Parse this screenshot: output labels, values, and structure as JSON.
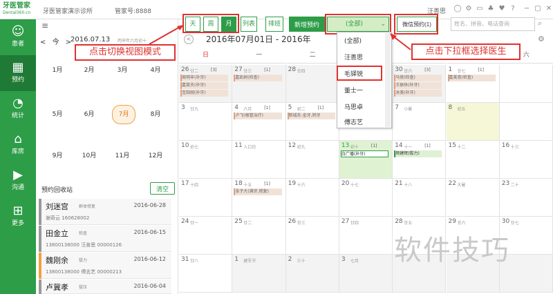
{
  "app": {
    "logo_name": "牙医管家",
    "logo_sub": "Dental360.cn",
    "clinic": "牙医管家演示诊所",
    "manager_label": "管家号:8888",
    "user": "汪善思"
  },
  "sidebar": [
    {
      "label": "患者",
      "icon": "person-icon"
    },
    {
      "label": "预约",
      "icon": "calendar-icon",
      "active": true
    },
    {
      "label": "统计",
      "icon": "pie-chart-icon"
    },
    {
      "label": "库房",
      "icon": "home-icon"
    },
    {
      "label": "沟通",
      "icon": "play-icon"
    },
    {
      "label": "更多",
      "icon": "grid-icon"
    }
  ],
  "left": {
    "prev": "<",
    "today": "今",
    "next": ">",
    "date": "2016.07.13",
    "lunar": "丙申年六月初十",
    "months": [
      "1月",
      "2月",
      "3月",
      "4月",
      "5月",
      "6月",
      "7月",
      "8月",
      "9月",
      "10月",
      "11月",
      "12月"
    ],
    "selected_month": "7月",
    "recall_title": "预约回收站",
    "clear": "清空",
    "recalls": [
      {
        "name": "刘迷宫",
        "tag": "群体修复",
        "date": "2016-06-28",
        "l2": "谢奇云            160628002",
        "color": "#999999"
      },
      {
        "name": "田金立",
        "tag": "检查",
        "date": "2016-06-15",
        "l2": "13800138000  汪善思    00000126",
        "color": "#999999"
      },
      {
        "name": "魏刚余",
        "tag": "拔力",
        "date": "2016-06-12",
        "l2": "13800138000  傅志艺    00000213",
        "color": "#f0a040"
      },
      {
        "name": "卢冀孝",
        "tag": "拔压",
        "date": "2016-06-04",
        "l2": "",
        "color": "#999999"
      }
    ]
  },
  "toolbar": {
    "view_day": "天",
    "view_week": "周",
    "view_month": "月",
    "view_list": "列表",
    "view_schedule": "排班",
    "new_appointment": "新增预约",
    "doctor_select": "(全部)",
    "wechat": "微信预约(1)",
    "search_placeholder": "姓名、拼音、电话查询"
  },
  "calendar": {
    "range": "2016年07月01日 - 2016年",
    "weekdays": [
      "日",
      "一",
      "二",
      "三",
      "四",
      "五",
      "六"
    ],
    "rows": [
      [
        {
          "d": "26",
          "lu": "廿二",
          "cnt": "[3]",
          "grey": true,
          "events": [
            "周明丰(补牙)",
            "嘉棠夫(补牙)",
            "宝田胡(补牙)"
          ]
        },
        {
          "d": "27",
          "lu": "廿三",
          "cnt": "[1]",
          "grey": true,
          "events": [
            "嘉凯树(检查)"
          ]
        },
        {
          "d": "28",
          "lu": "廿四",
          "cnt": "",
          "grey": true,
          "events": []
        },
        {
          "d": "29",
          "lu": "",
          "cnt": "",
          "grey": true,
          "events": []
        },
        {
          "d": "30",
          "lu": "廿六",
          "cnt": "[3]",
          "grey": true,
          "events": [
            "马修(检查)",
            "王振休(补牙)",
            "冰美(补牙)"
          ]
        },
        {
          "d": "1",
          "lu": "廿七",
          "cnt": "[1]",
          "events": [
            "嘉美育(检查)"
          ]
        },
        {
          "d": "",
          "lu": "",
          "cnt": "",
          "events": []
        }
      ],
      [
        {
          "d": "3",
          "lu": "廿九",
          "cnt": "",
          "events": []
        },
        {
          "d": "4",
          "lu": "六月",
          "cnt": "[1]",
          "events": [
            "卢飞(根管治疗)"
          ]
        },
        {
          "d": "5",
          "lu": "初二",
          "cnt": "[1]",
          "events": [
            "新城东-金牙,矫牙"
          ]
        },
        {
          "d": "6",
          "lu": "初三",
          "cnt": "",
          "events": []
        },
        {
          "d": "7",
          "lu": "小暑",
          "cnt": "",
          "events": []
        },
        {
          "d": "8",
          "lu": "初五",
          "cnt": "",
          "yellow": true,
          "events": []
        },
        {
          "d": "",
          "lu": "",
          "cnt": "",
          "events": []
        }
      ],
      [
        {
          "d": "10",
          "lu": "初七",
          "cnt": "",
          "events": []
        },
        {
          "d": "11",
          "lu": "入口日",
          "cnt": "",
          "events": []
        },
        {
          "d": "12",
          "lu": "初九",
          "cnt": "",
          "events": []
        },
        {
          "d": "13",
          "lu": "初十",
          "cnt": "[1]",
          "green": true,
          "events": [
            "白广播(补牙)"
          ]
        },
        {
          "d": "14",
          "lu": "十一",
          "cnt": "[1]",
          "events": [
            "颜建辉(拔力)"
          ]
        },
        {
          "d": "15",
          "lu": "十二",
          "cnt": "",
          "events": []
        },
        {
          "d": "16",
          "lu": "十三",
          "cnt": "",
          "events": []
        }
      ],
      [
        {
          "d": "17",
          "lu": "十四",
          "cnt": "",
          "events": []
        },
        {
          "d": "18",
          "lu": "十五",
          "cnt": "[1]",
          "events": [
            "张子大(满牙,修复)"
          ]
        },
        {
          "d": "19",
          "lu": "十六",
          "cnt": "",
          "events": []
        },
        {
          "d": "20",
          "lu": "十七",
          "cnt": "",
          "events": []
        },
        {
          "d": "21",
          "lu": "十八",
          "cnt": "",
          "events": []
        },
        {
          "d": "22",
          "lu": "大暑",
          "cnt": "",
          "events": []
        },
        {
          "d": "23",
          "lu": "二十",
          "cnt": "",
          "events": []
        }
      ],
      [
        {
          "d": "24",
          "lu": "廿一",
          "cnt": "",
          "events": []
        },
        {
          "d": "25",
          "lu": "廿二",
          "cnt": "",
          "events": []
        },
        {
          "d": "26",
          "lu": "廿三",
          "cnt": "",
          "events": []
        },
        {
          "d": "27",
          "lu": "廿四",
          "cnt": "",
          "events": []
        },
        {
          "d": "28",
          "lu": "廿五",
          "cnt": "",
          "events": []
        },
        {
          "d": "29",
          "lu": "廿六",
          "cnt": "",
          "events": []
        },
        {
          "d": "30",
          "lu": "廿七",
          "cnt": "",
          "events": []
        }
      ],
      [
        {
          "d": "31",
          "lu": "廿八",
          "cnt": "",
          "events": []
        },
        {
          "d": "1",
          "lu": "建军节",
          "cnt": "",
          "grey": true,
          "events": []
        },
        {
          "d": "2",
          "lu": "三十",
          "cnt": "",
          "grey": true,
          "events": []
        },
        {
          "d": "3",
          "lu": "七月",
          "cnt": "",
          "grey": true,
          "events": []
        },
        {
          "d": "",
          "lu": "",
          "cnt": "",
          "grey": true,
          "events": []
        },
        {
          "d": "",
          "lu": "",
          "cnt": "",
          "grey": true,
          "events": []
        },
        {
          "d": "",
          "lu": "",
          "cnt": "",
          "grey": true,
          "events": []
        }
      ]
    ]
  },
  "dropdown": {
    "items": [
      "(全部)",
      "汪善思",
      "毛铎锐",
      "董士一",
      "马思卓",
      "傅志艺"
    ],
    "selected": "毛铎锐"
  },
  "annotations": {
    "view_hint": "点击切换视图模式",
    "doctor_hint": "点击下拉框选择医生"
  },
  "watermark": "软件技巧",
  "colors": {
    "brand": "#2d9d48",
    "annotation": "#e03030"
  }
}
